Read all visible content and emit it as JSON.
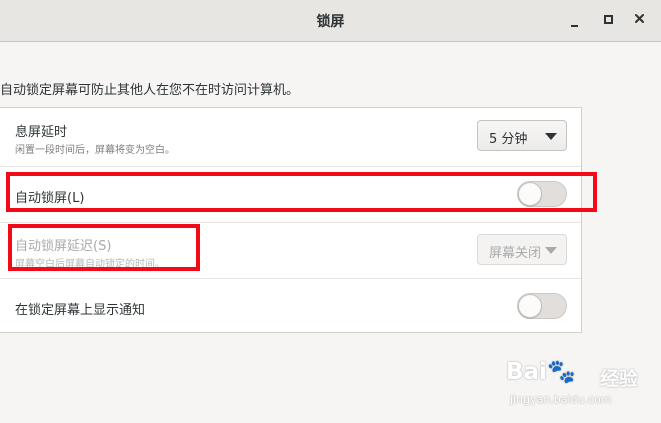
{
  "window": {
    "title": "锁屏",
    "minimize_icon": "minimize-icon",
    "maximize_icon": "maximize-icon",
    "close_icon": "close-icon"
  },
  "description": "自动锁定屏幕可防止其他人在您不在时访问计算机。",
  "settings": {
    "blank_delay": {
      "title": "息屏延时",
      "subtitle": "闲置一段时间后，屏幕将变为空白。",
      "value": "5 分钟"
    },
    "auto_lock": {
      "title": "自动锁屏(L)",
      "enabled": false
    },
    "auto_lock_delay": {
      "title": "自动锁屏延迟(S)",
      "subtitle": "屏幕空白后屏幕自动锁定的时间。",
      "value": "屏幕关闭",
      "disabled": true
    },
    "lock_notifications": {
      "title": "在锁定屏幕上显示通知",
      "enabled": false
    }
  },
  "annotation_color": "#f20a16",
  "watermark": {
    "logo": "Baidu经验",
    "url": "jingyan.baidu.com"
  }
}
